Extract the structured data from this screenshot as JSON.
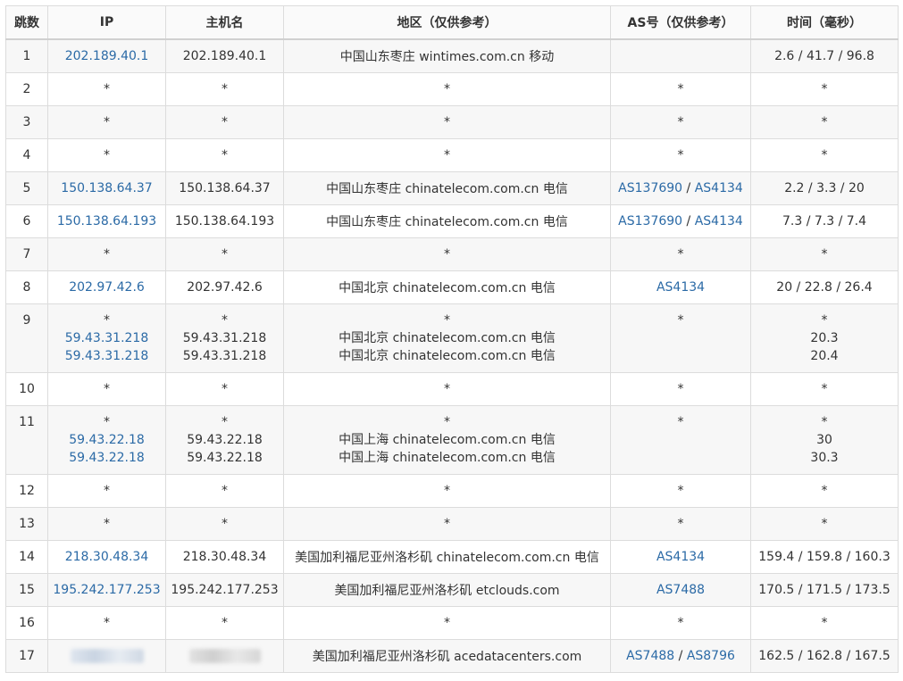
{
  "headers": {
    "hop": "跳数",
    "ip": "IP",
    "host": "主机名",
    "region": "地区（仅供参考）",
    "as": "AS号（仅供参考）",
    "time": "时间（毫秒）"
  },
  "separator": " / ",
  "rows": [
    {
      "hop": "1",
      "ip": [
        "202.189.40.1"
      ],
      "host": [
        "202.189.40.1"
      ],
      "region": [
        "中国山东枣庄 wintimes.com.cn 移动"
      ],
      "as": [],
      "time": [
        "2.6 / 41.7 / 96.8"
      ]
    },
    {
      "hop": "2",
      "ip": [
        "*"
      ],
      "host": [
        "*"
      ],
      "region": [
        "*"
      ],
      "as": [
        "*"
      ],
      "time": [
        "*"
      ]
    },
    {
      "hop": "3",
      "ip": [
        "*"
      ],
      "host": [
        "*"
      ],
      "region": [
        "*"
      ],
      "as": [
        "*"
      ],
      "time": [
        "*"
      ]
    },
    {
      "hop": "4",
      "ip": [
        "*"
      ],
      "host": [
        "*"
      ],
      "region": [
        "*"
      ],
      "as": [
        "*"
      ],
      "time": [
        "*"
      ]
    },
    {
      "hop": "5",
      "ip": [
        "150.138.64.37"
      ],
      "host": [
        "150.138.64.37"
      ],
      "region": [
        "中国山东枣庄 chinatelecom.com.cn 电信"
      ],
      "as": [
        "AS137690",
        "AS4134"
      ],
      "time": [
        "2.2 / 3.3 / 20"
      ]
    },
    {
      "hop": "6",
      "ip": [
        "150.138.64.193"
      ],
      "host": [
        "150.138.64.193"
      ],
      "region": [
        "中国山东枣庄 chinatelecom.com.cn 电信"
      ],
      "as": [
        "AS137690",
        "AS4134"
      ],
      "time": [
        "7.3 / 7.3 / 7.4"
      ]
    },
    {
      "hop": "7",
      "ip": [
        "*"
      ],
      "host": [
        "*"
      ],
      "region": [
        "*"
      ],
      "as": [
        "*"
      ],
      "time": [
        "*"
      ]
    },
    {
      "hop": "8",
      "ip": [
        "202.97.42.6"
      ],
      "host": [
        "202.97.42.6"
      ],
      "region": [
        "中国北京 chinatelecom.com.cn 电信"
      ],
      "as": [
        "AS4134"
      ],
      "time": [
        "20 / 22.8 / 26.4"
      ]
    },
    {
      "hop": "9",
      "multi": true,
      "ip": [
        "*",
        "59.43.31.218",
        "59.43.31.218"
      ],
      "host": [
        "*",
        "59.43.31.218",
        "59.43.31.218"
      ],
      "region": [
        "*",
        "中国北京 chinatelecom.com.cn 电信",
        "中国北京 chinatelecom.com.cn 电信"
      ],
      "as": [
        "*"
      ],
      "time": [
        "*",
        "20.3",
        "20.4"
      ]
    },
    {
      "hop": "10",
      "ip": [
        "*"
      ],
      "host": [
        "*"
      ],
      "region": [
        "*"
      ],
      "as": [
        "*"
      ],
      "time": [
        "*"
      ]
    },
    {
      "hop": "11",
      "multi": true,
      "ip": [
        "*",
        "59.43.22.18",
        "59.43.22.18"
      ],
      "host": [
        "*",
        "59.43.22.18",
        "59.43.22.18"
      ],
      "region": [
        "*",
        "中国上海 chinatelecom.com.cn 电信",
        "中国上海 chinatelecom.com.cn 电信"
      ],
      "as": [
        "*"
      ],
      "time": [
        "*",
        "30",
        "30.3"
      ]
    },
    {
      "hop": "12",
      "ip": [
        "*"
      ],
      "host": [
        "*"
      ],
      "region": [
        "*"
      ],
      "as": [
        "*"
      ],
      "time": [
        "*"
      ]
    },
    {
      "hop": "13",
      "ip": [
        "*"
      ],
      "host": [
        "*"
      ],
      "region": [
        "*"
      ],
      "as": [
        "*"
      ],
      "time": [
        "*"
      ]
    },
    {
      "hop": "14",
      "ip": [
        "218.30.48.34"
      ],
      "host": [
        "218.30.48.34"
      ],
      "region": [
        "美国加利福尼亚州洛杉矶 chinatelecom.com.cn 电信"
      ],
      "as": [
        "AS4134"
      ],
      "time": [
        "159.4 / 159.8 / 160.3"
      ]
    },
    {
      "hop": "15",
      "ip": [
        "195.242.177.253"
      ],
      "host": [
        "195.242.177.253"
      ],
      "region": [
        "美国加利福尼亚州洛杉矶 etclouds.com"
      ],
      "as": [
        "AS7488"
      ],
      "time": [
        "170.5 / 171.5 / 173.5"
      ]
    },
    {
      "hop": "16",
      "ip": [
        "*"
      ],
      "host": [
        "*"
      ],
      "region": [
        "*"
      ],
      "as": [
        "*"
      ],
      "time": [
        "*"
      ]
    },
    {
      "hop": "17",
      "ip": [],
      "host": [],
      "redacted": true,
      "region": [
        "美国加利福尼亚州洛杉矶 acedatacenters.com"
      ],
      "as": [
        "AS7488",
        "AS8796"
      ],
      "time": [
        "162.5 / 162.8 / 167.5"
      ]
    }
  ],
  "colors": {
    "link": "#2b6aa6",
    "text": "#333333",
    "border": "#dcdcdc",
    "stripe": "#f7f7f7"
  }
}
